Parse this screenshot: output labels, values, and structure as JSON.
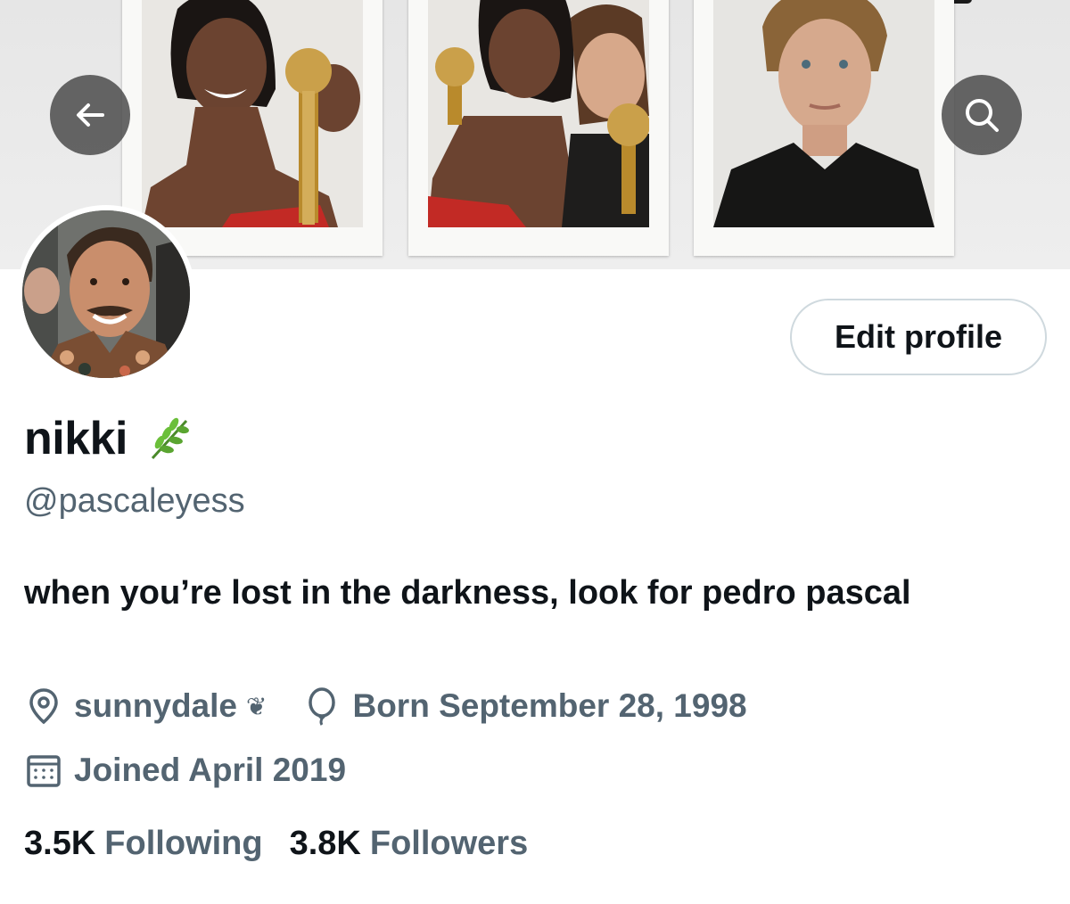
{
  "banner": {
    "photos": [
      {
        "name": "polaroid-1"
      },
      {
        "name": "polaroid-2"
      },
      {
        "name": "polaroid-3"
      }
    ]
  },
  "nav": {
    "back_icon": "arrow-left-icon",
    "search_icon": "search-icon"
  },
  "profile": {
    "display_name": "nikki",
    "name_emoji": "herb-emoji",
    "handle": "@pascaleyess",
    "edit_label": "Edit profile",
    "bio": "when you’re lost in the darkness, look for pedro pascal",
    "location": "sunnydale",
    "location_glyph": "❦",
    "birthday": "Born September 28, 1998",
    "joined": "Joined April 2019",
    "following_count": "3.5K",
    "following_label": "Following",
    "followers_count": "3.8K",
    "followers_label": "Followers"
  },
  "colors": {
    "text_primary": "#0f1419",
    "text_secondary": "#536471",
    "border": "#cfd9de",
    "nav_button": "#464646"
  }
}
